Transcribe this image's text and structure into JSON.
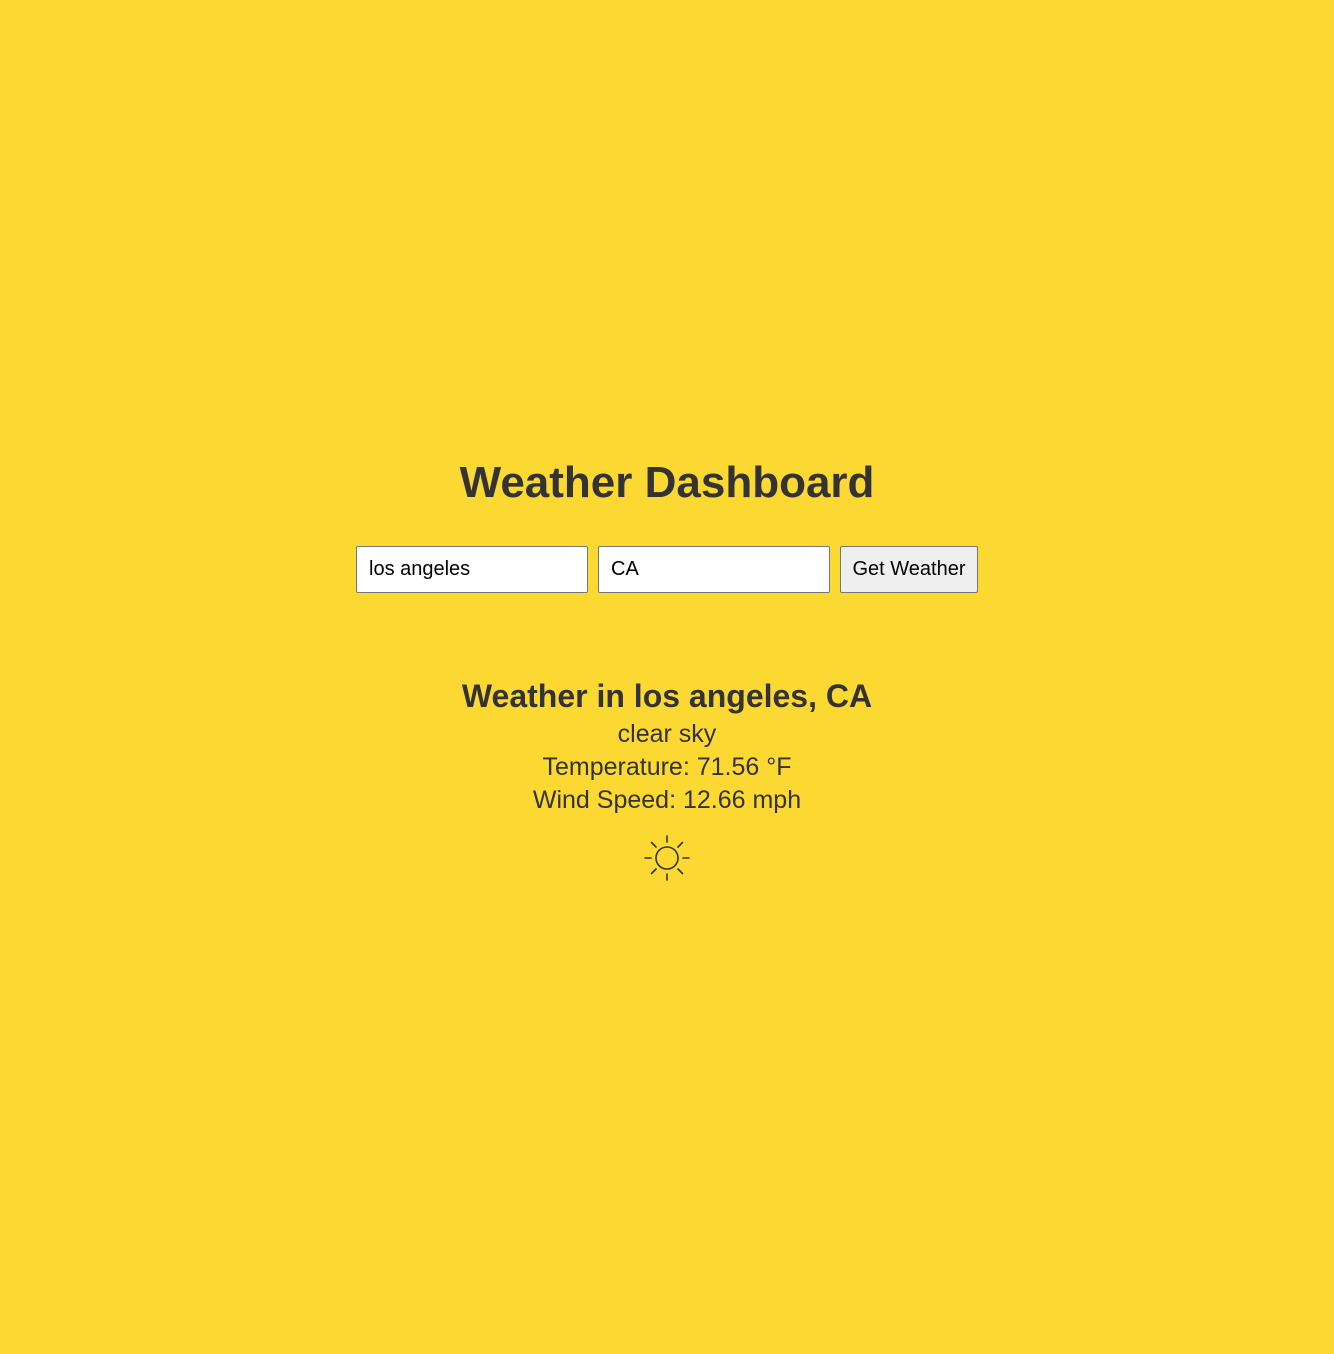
{
  "header": {
    "title": "Weather Dashboard"
  },
  "search": {
    "city_value": "los angeles",
    "state_value": "CA",
    "submit_label": "Get Weather"
  },
  "result": {
    "heading": "Weather in los angeles, CA",
    "description": "clear sky",
    "temperature": "Temperature: 71.56 °F",
    "wind_speed": "Wind Speed: 12.66 mph",
    "icon": "sun-icon"
  },
  "colors": {
    "background": "#fcd832",
    "text": "#333333"
  }
}
